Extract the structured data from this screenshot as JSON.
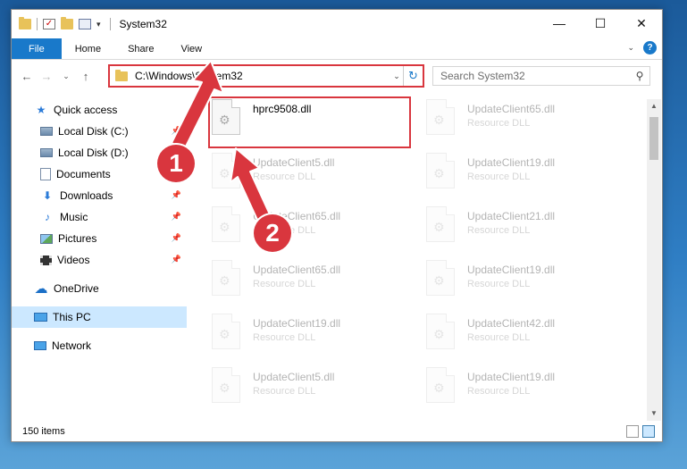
{
  "window": {
    "title": "System32",
    "controls": {
      "minimize": "—",
      "maximize": "☐",
      "close": "✕"
    }
  },
  "ribbon": {
    "tabs": [
      "File",
      "Home",
      "Share",
      "View"
    ],
    "help": "?"
  },
  "nav": {
    "back": "←",
    "forward": "→",
    "recent": "⌄",
    "up": "↑",
    "address": "C:\\Windows\\System32",
    "search_placeholder": "Search System32"
  },
  "sidebar": {
    "items": [
      {
        "label": "Quick access",
        "icon": "star-icon",
        "pinned": false
      },
      {
        "label": "Local Disk (C:)",
        "icon": "drive-icon",
        "pinned": true
      },
      {
        "label": "Local Disk (D:)",
        "icon": "drive-icon",
        "pinned": false
      },
      {
        "label": "Documents",
        "icon": "documents-icon",
        "pinned": true
      },
      {
        "label": "Downloads",
        "icon": "downloads-icon",
        "pinned": true
      },
      {
        "label": "Music",
        "icon": "music-icon",
        "pinned": true
      },
      {
        "label": "Pictures",
        "icon": "pictures-icon",
        "pinned": true
      },
      {
        "label": "Videos",
        "icon": "videos-icon",
        "pinned": true
      },
      {
        "label": "OneDrive",
        "icon": "onedrive-icon",
        "pinned": false
      },
      {
        "label": "This PC",
        "icon": "this-pc-icon",
        "pinned": false,
        "selected": true
      },
      {
        "label": "Network",
        "icon": "network-icon",
        "pinned": false
      }
    ]
  },
  "files": {
    "highlighted": {
      "name": "hprc9508.dll",
      "type": ""
    },
    "items": [
      {
        "name": "UpdateClient65.dll",
        "type": "Resource DLL"
      },
      {
        "name": "UpdateClient5.dll",
        "type": "Resource DLL"
      },
      {
        "name": "UpdateClient19.dll",
        "type": "Resource DLL"
      },
      {
        "name": "UpdateClient65.dll",
        "type": "Resource DLL"
      },
      {
        "name": "UpdateClient21.dll",
        "type": "Resource DLL"
      },
      {
        "name": "UpdateClient65.dll",
        "type": "Resource DLL"
      },
      {
        "name": "UpdateClient19.dll",
        "type": "Resource DLL"
      },
      {
        "name": "UpdateClient19.dll",
        "type": "Resource DLL"
      },
      {
        "name": "UpdateClient42.dll",
        "type": "Resource DLL"
      },
      {
        "name": "UpdateClient5.dll",
        "type": "Resource DLL"
      },
      {
        "name": "UpdateClient19.dll",
        "type": "Resource DLL"
      }
    ]
  },
  "status": {
    "count": "150 items"
  },
  "callouts": {
    "step1": "1",
    "step2": "2"
  },
  "colors": {
    "accent": "#1979ca",
    "annotation": "#d9363e",
    "selected": "#cce8ff"
  }
}
